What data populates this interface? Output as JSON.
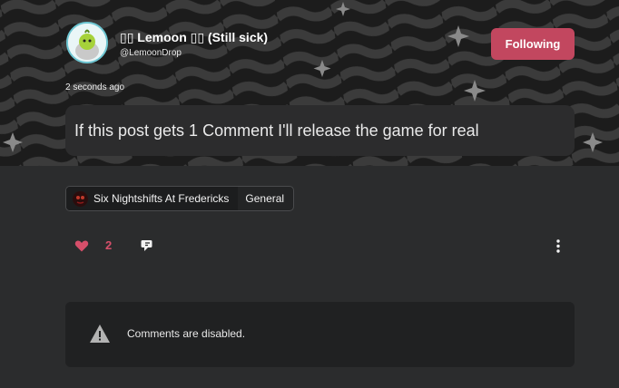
{
  "post": {
    "author_name": "▯▯ Lemoon ▯▯ (Still sick)",
    "author_handle": "@LemoonDrop",
    "follow_label": "Following",
    "timestamp": "2 seconds ago",
    "content": "If this post gets 1 Comment I'll release the game for real"
  },
  "tags": {
    "game": "Six Nightshifts At Fredericks",
    "category": "General"
  },
  "actions": {
    "likes": "2",
    "like_icon": "heart-icon",
    "share_icon": "share-icon",
    "more_icon": "more-vertical-icon"
  },
  "comments": {
    "disabled_text": "Comments are disabled.",
    "icon": "warning-icon"
  },
  "colors": {
    "accent": "#c2475f",
    "like": "#d64f6a",
    "background": "#2b2c2d"
  }
}
